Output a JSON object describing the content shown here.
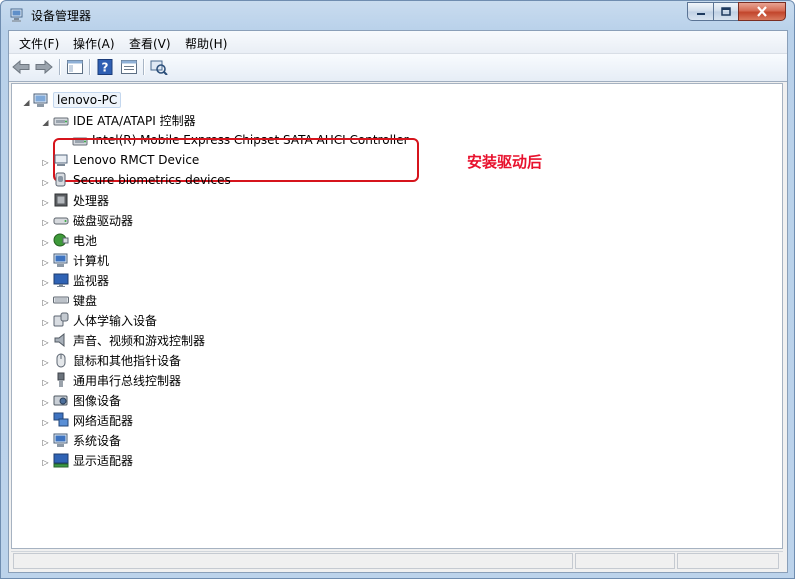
{
  "window": {
    "title": "设备管理器"
  },
  "menu": [
    {
      "label": "文件(F)"
    },
    {
      "label": "操作(A)"
    },
    {
      "label": "查看(V)"
    },
    {
      "label": "帮助(H)"
    }
  ],
  "tree": {
    "root": {
      "label": "lenovo-PC"
    },
    "expanded": {
      "label": "IDE ATA/ATAPI 控制器",
      "child": "Intel(R) Mobile Express Chipset SATA AHCI Controller"
    },
    "items": [
      {
        "label": "Lenovo RMCT Device",
        "icon": "device-icon"
      },
      {
        "label": "Secure biometrics devices",
        "icon": "biometric-icon"
      },
      {
        "label": "处理器",
        "icon": "processor-icon"
      },
      {
        "label": "磁盘驱动器",
        "icon": "disk-drive-icon"
      },
      {
        "label": "电池",
        "icon": "battery-icon"
      },
      {
        "label": "计算机",
        "icon": "computer-icon"
      },
      {
        "label": "监视器",
        "icon": "monitor-icon"
      },
      {
        "label": "键盘",
        "icon": "keyboard-icon"
      },
      {
        "label": "人体学输入设备",
        "icon": "hid-icon"
      },
      {
        "label": "声音、视频和游戏控制器",
        "icon": "speaker-icon"
      },
      {
        "label": "鼠标和其他指针设备",
        "icon": "mouse-icon"
      },
      {
        "label": "通用串行总线控制器",
        "icon": "usb-icon"
      },
      {
        "label": "图像设备",
        "icon": "camera-icon"
      },
      {
        "label": "网络适配器",
        "icon": "network-icon"
      },
      {
        "label": "系统设备",
        "icon": "system-device-icon"
      },
      {
        "label": "显示适配器",
        "icon": "display-adapter-icon"
      }
    ]
  },
  "annotation": {
    "text": "安装驱动后"
  }
}
